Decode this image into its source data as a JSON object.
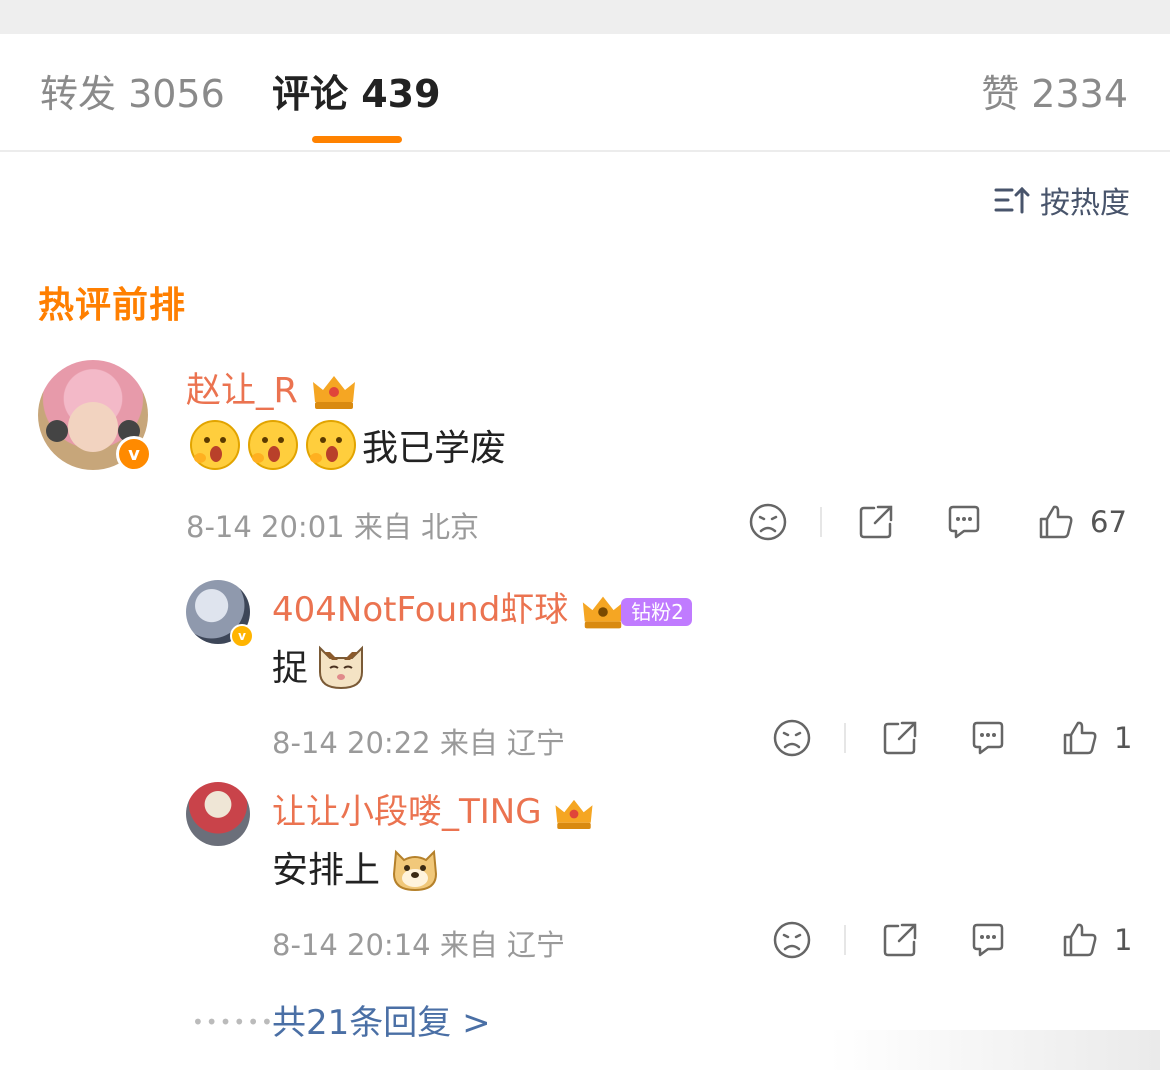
{
  "tabs": {
    "repost": "转发 3056",
    "comments": "评论 439",
    "likes": "赞 2334"
  },
  "sort_label": "按热度",
  "section_title": "热评前排",
  "comment": {
    "author": "赵让_R",
    "text": "我已学废",
    "time_location": "8-14 20:01 来自 北京",
    "likes": "67"
  },
  "replies": [
    {
      "author": "404NotFound虾球",
      "fan_badge": "钻粉2",
      "text": "捉",
      "time_location": "8-14 20:22 来自 辽宁",
      "likes": "1"
    },
    {
      "author": "让让小段喽_TING",
      "text": "安排上",
      "time_location": "8-14 20:14 来自 辽宁",
      "likes": "1"
    }
  ],
  "more_replies": "共21条回复 >",
  "colors": {
    "accent": "#ff8200",
    "name": "#eb7350",
    "link": "#4a6fa5"
  }
}
